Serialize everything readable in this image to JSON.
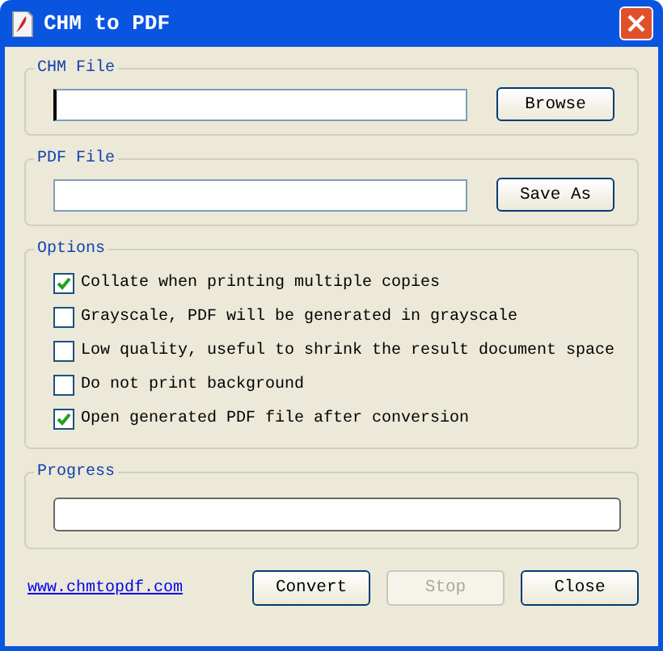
{
  "window": {
    "title": "CHM to PDF"
  },
  "chm_file": {
    "label": "CHM File",
    "button": "Browse",
    "focused": true
  },
  "pdf_file": {
    "label": "PDF File",
    "button": "Save As",
    "focused": false
  },
  "options": {
    "label": "Options",
    "items": [
      {
        "label": "Collate when printing multiple copies",
        "checked": true
      },
      {
        "label": "Grayscale, PDF will be generated in grayscale",
        "checked": false
      },
      {
        "label": "Low quality, useful to shrink the result document space",
        "checked": false
      },
      {
        "label": "Do not print background",
        "checked": false
      },
      {
        "label": "Open generated PDF file after conversion",
        "checked": true
      }
    ]
  },
  "progress": {
    "label": "Progress",
    "level": 0
  },
  "link": "www.chmtopdf.com",
  "buttons": [
    {
      "label": "Convert",
      "disabled": false
    },
    {
      "label": "Stop",
      "disabled": true
    },
    {
      "label": "Close",
      "disabled": false
    }
  ]
}
